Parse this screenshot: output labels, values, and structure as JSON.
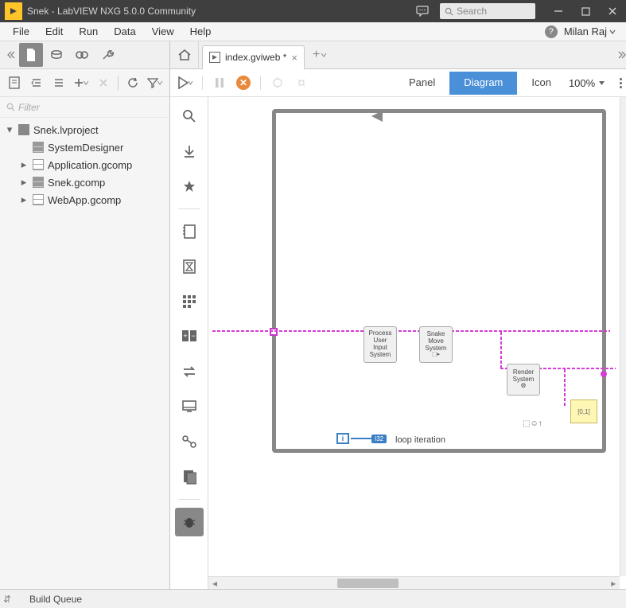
{
  "title_bar": {
    "app_title": "Snek - LabVIEW NXG 5.0.0 Community",
    "search_placeholder": "Search"
  },
  "menu": {
    "items": [
      "File",
      "Edit",
      "Run",
      "Data",
      "View",
      "Help"
    ],
    "user_name": "Milan Raj"
  },
  "filter_placeholder": "Filter",
  "tree": {
    "root": "Snek.lvproject",
    "children": [
      {
        "label": "SystemDesigner"
      },
      {
        "label": "Application.gcomp"
      },
      {
        "label": "Snek.gcomp"
      },
      {
        "label": "WebApp.gcomp"
      }
    ]
  },
  "tab": {
    "label": "index.gviweb *"
  },
  "view_tabs": {
    "panel": "Panel",
    "diagram": "Diagram",
    "icon": "Icon"
  },
  "zoom": "100%",
  "diagram": {
    "process_user_input": "Process\nUser\nInput\nSystem",
    "snake_move": "Snake\nMove\nSystem",
    "render_system": "Render\nSystem",
    "array_label": "[0,1]",
    "i32_label": "I32",
    "i_label": "i",
    "loop_iteration": "loop iteration"
  },
  "status": {
    "build_queue": "Build Queue"
  }
}
